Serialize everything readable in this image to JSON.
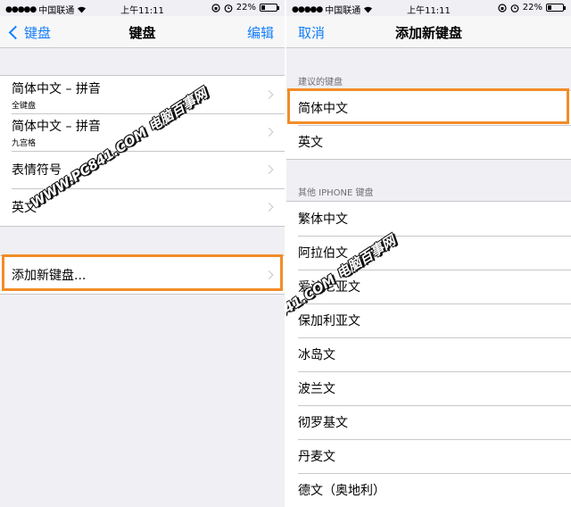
{
  "status_bar": {
    "signal_dots": "●●●●●",
    "carrier": "中国联通",
    "wifi_icon": "wifi-icon",
    "time": "上午11:11",
    "battery_percent": "22%",
    "battery_level": 0.22
  },
  "left_screen": {
    "nav": {
      "back_label": "键盘",
      "title": "键盘",
      "edit_label": "编辑"
    },
    "keyboards": [
      {
        "label": "简体中文 – 拼音",
        "sub": "全键盘"
      },
      {
        "label": "简体中文 – 拼音",
        "sub": "九宫格"
      },
      {
        "label": "表情符号",
        "sub": ""
      },
      {
        "label": "英文",
        "sub": ""
      }
    ],
    "add_new": {
      "label": "添加新键盘..."
    }
  },
  "right_screen": {
    "nav": {
      "cancel_label": "取消",
      "title": "添加新键盘"
    },
    "suggested_header": "建议的键盘",
    "suggested": [
      "简体中文",
      "英文"
    ],
    "other_header": "其他 IPHONE 键盘",
    "others": [
      "繁体中文",
      "阿拉伯文",
      "爱沙尼亚文",
      "保加利亚文",
      "冰岛文",
      "波兰文",
      "彻罗基文",
      "丹麦文",
      "德文（奥地利）"
    ]
  },
  "watermark": {
    "text": "WWW.PC841.COM 电脑百事网"
  },
  "colors": {
    "accent": "#147efb",
    "highlight": "#f28c28",
    "background": "#efeff4"
  }
}
